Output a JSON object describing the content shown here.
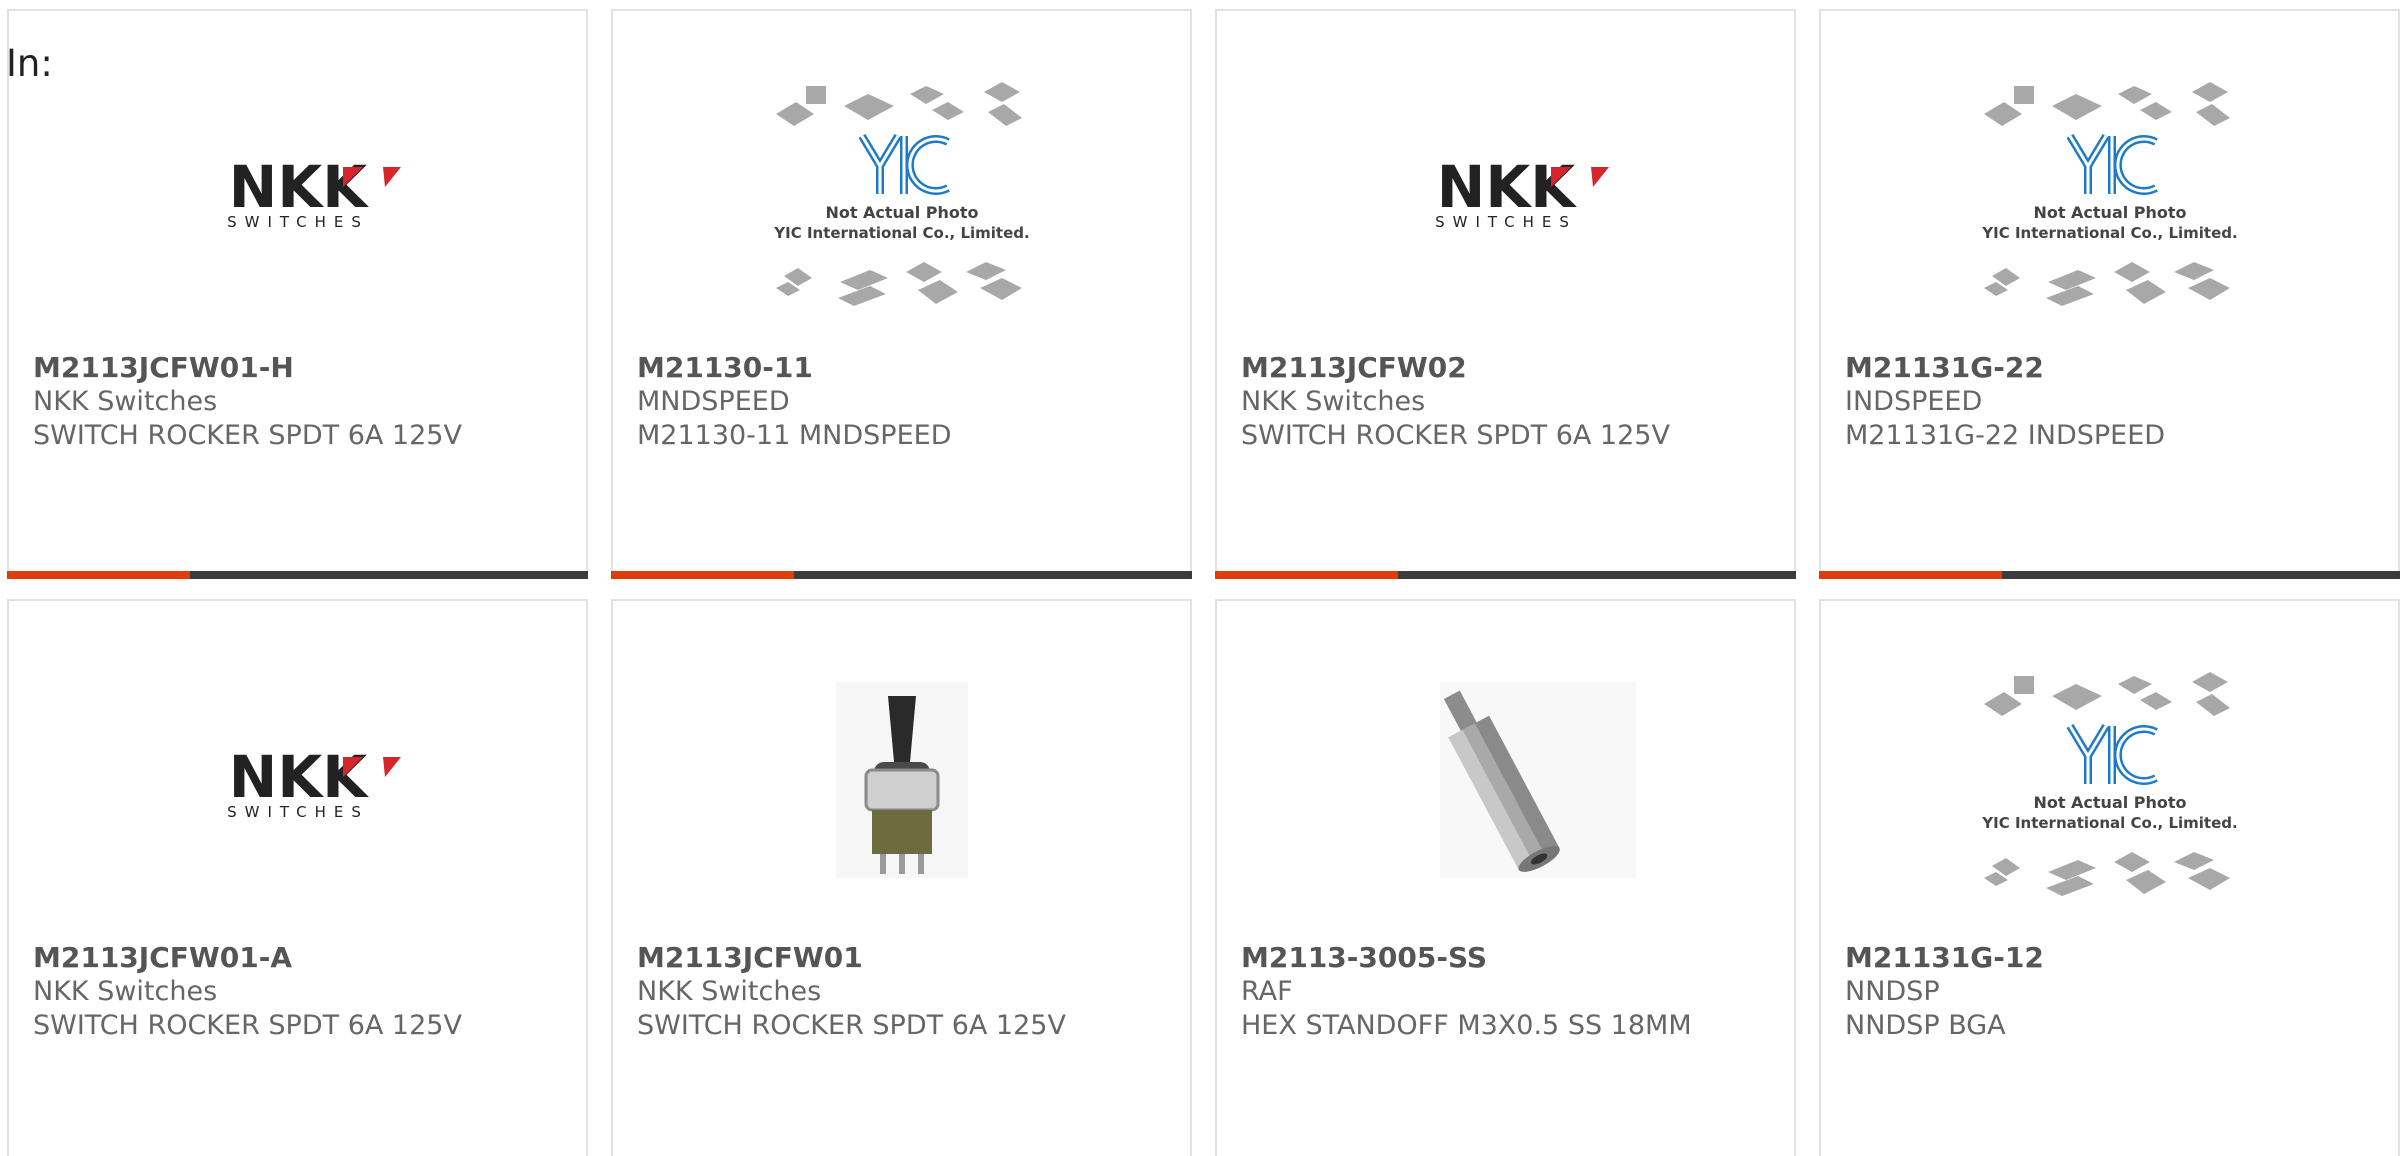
{
  "header": {
    "in_label": "In:"
  },
  "colors": {
    "accent": "#e03c0c",
    "bar": "#3c3c3c",
    "border": "#e2e2e2",
    "nkk_red": "#d6262c"
  },
  "logos": {
    "nkk": {
      "main": "NKK",
      "sub": "SWITCHES"
    },
    "yic": {
      "line1": "Not Actual Photo",
      "line2": "YIC International Co., Limited."
    }
  },
  "products": [
    {
      "part": "M2113JCFW01-H",
      "manufacturer": "NKK Switches",
      "description": "SWITCH ROCKER SPDT 6A 125V",
      "image": "nkk-logo"
    },
    {
      "part": "M21130-11",
      "manufacturer": "MNDSPEED",
      "description": "M21130-11 MNDSPEED",
      "image": "yic-placeholder"
    },
    {
      "part": "M2113JCFW02",
      "manufacturer": "NKK Switches",
      "description": "SWITCH ROCKER SPDT 6A 125V",
      "image": "nkk-logo"
    },
    {
      "part": "M21131G-22",
      "manufacturer": "INDSPEED",
      "description": "M21131G-22 INDSPEED",
      "image": "yic-placeholder"
    },
    {
      "part": "M2113JCFW01-A",
      "manufacturer": "NKK Switches",
      "description": "SWITCH ROCKER SPDT 6A 125V",
      "image": "nkk-logo"
    },
    {
      "part": "M2113JCFW01",
      "manufacturer": "NKK Switches",
      "description": "SWITCH ROCKER SPDT 6A 125V",
      "image": "rocker-switch-photo"
    },
    {
      "part": "M2113-3005-SS",
      "manufacturer": "RAF",
      "description": "HEX STANDOFF M3X0.5 SS 18MM",
      "image": "hex-standoff-photo"
    },
    {
      "part": "M21131G-12",
      "manufacturer": "NNDSP",
      "description": "NNDSP BGA",
      "image": "yic-placeholder"
    }
  ]
}
